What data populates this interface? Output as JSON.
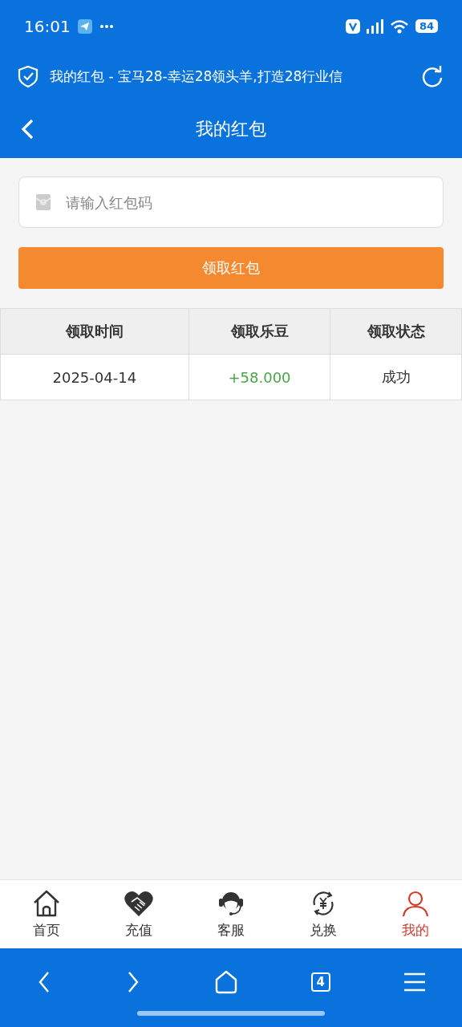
{
  "status_bar": {
    "time": "16:01",
    "battery": "84"
  },
  "browser_bar": {
    "title": "我的红包 - 宝马28-幸运28领头羊,打造28行业信"
  },
  "header": {
    "title": "我的红包"
  },
  "code_field": {
    "placeholder": "请输入红包码"
  },
  "claim_button": "领取红包",
  "table": {
    "columns": [
      "领取时间",
      "领取乐豆",
      "领取状态"
    ],
    "rows": [
      [
        "2025-04-14",
        "+58.000",
        "成功"
      ]
    ]
  },
  "tab_bar": [
    {
      "kind": "home",
      "label": "首页",
      "selected": false
    },
    {
      "kind": "recharge",
      "label": "充值",
      "selected": false
    },
    {
      "kind": "service",
      "label": "客服",
      "selected": false
    },
    {
      "kind": "exchange",
      "label": "兑换",
      "selected": false
    },
    {
      "kind": "profile",
      "label": "我的",
      "selected": true
    }
  ],
  "browser_nav": {
    "tab_count": "4"
  }
}
